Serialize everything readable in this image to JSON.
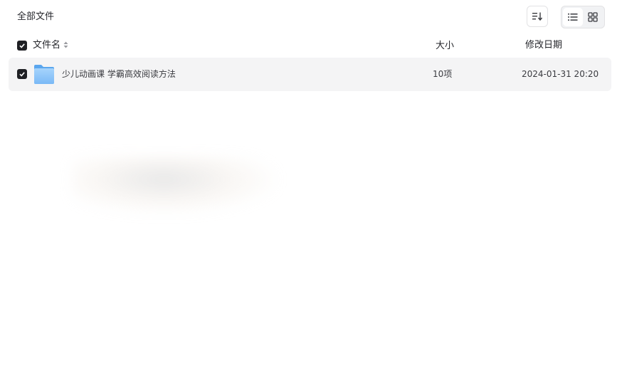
{
  "breadcrumb": {
    "title": "全部文件"
  },
  "toolbar": {
    "sort_icon": "sort-descending-icon",
    "view_modes": [
      {
        "name": "list",
        "icon": "list-view-icon",
        "active": true
      },
      {
        "name": "grid",
        "icon": "grid-view-icon",
        "active": false
      }
    ]
  },
  "table": {
    "select_all_checked": true,
    "columns": {
      "name": "文件名",
      "size": "大小",
      "modified": "修改日期"
    },
    "rows": [
      {
        "checked": true,
        "type": "folder",
        "icon": "folder-icon",
        "name": "少儿动画课 学霸高效阅读方法",
        "size": "10项",
        "modified": "2024-01-31 20:20"
      }
    ]
  },
  "colors": {
    "checkbox": "#1f2024",
    "row_selected_bg": "#f4f4f5",
    "folder_blue": "#7cbcf7"
  }
}
